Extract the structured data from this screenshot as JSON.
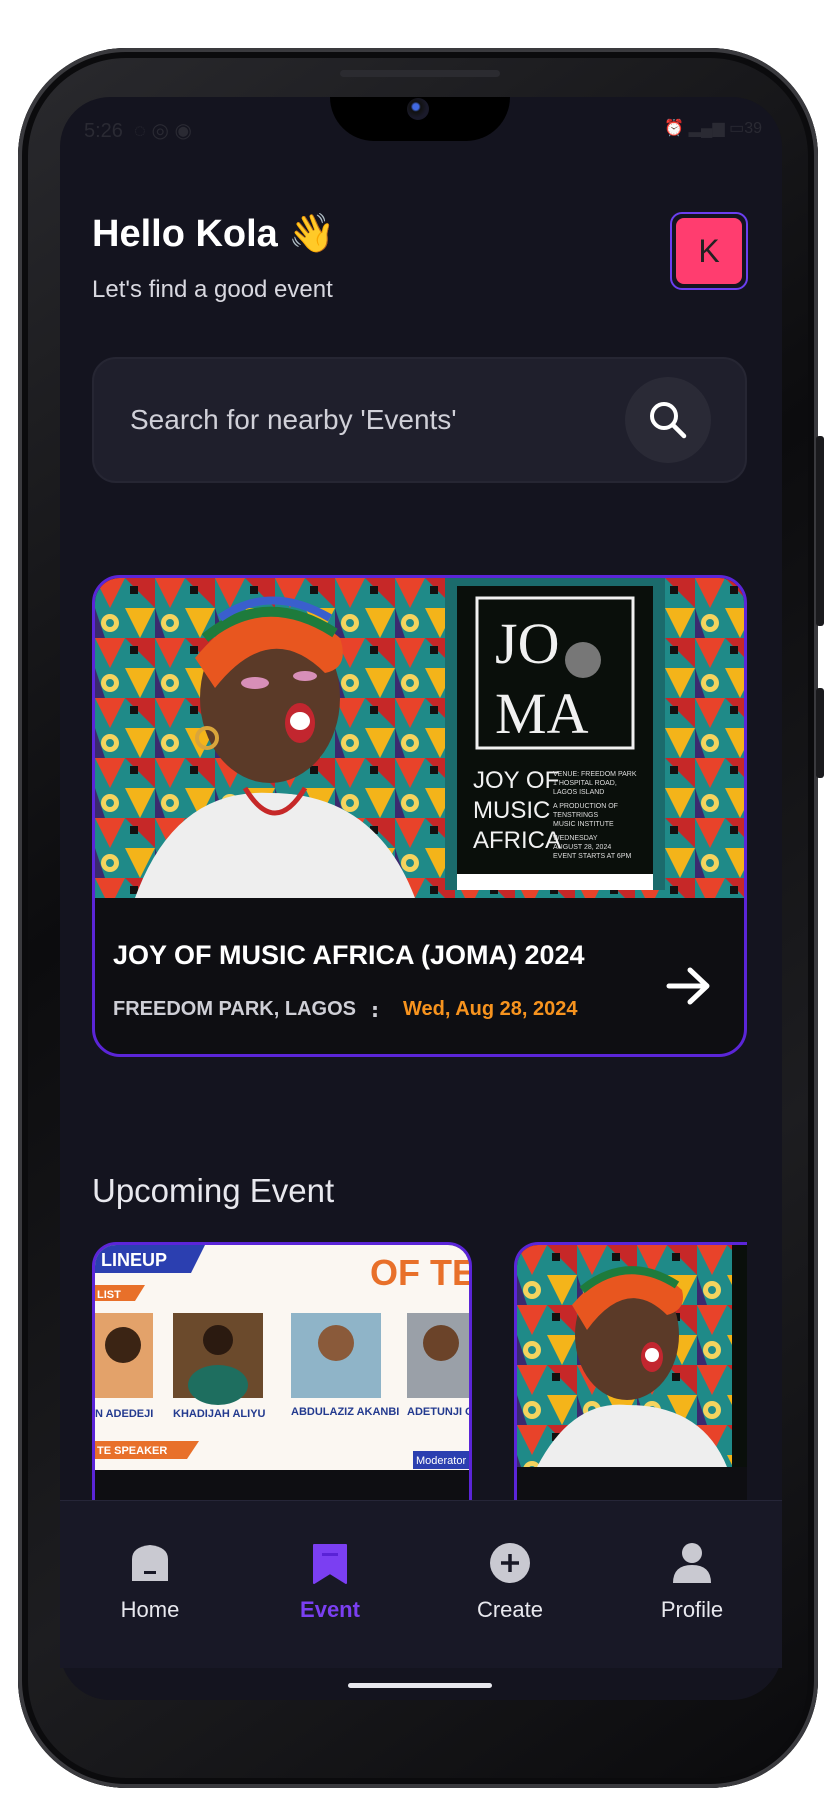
{
  "status": {
    "time": "5:26",
    "battery": "39"
  },
  "header": {
    "greeting": "Hello Kola 👋",
    "subtitle": "Let's find a good event",
    "avatar_initial": "K"
  },
  "search": {
    "placeholder": "Search for nearby 'Events'"
  },
  "featured": {
    "title": "JOY OF MUSIC AFRICA (JOMA) 2024",
    "location": "FREEDOM PARK, LAGOS",
    "separator": ":",
    "date": "Wed, Aug 28, 2024",
    "poster": {
      "logo_line1": "JO",
      "logo_line2": "MA",
      "name_line1": "JOY OF",
      "name_line2": "MUSIC",
      "name_line3": "AFRICA",
      "venue_lines": [
        "VENUE: FREEDOM PARK",
        "1 HOSPITAL ROAD,",
        "LAGOS ISLAND"
      ],
      "production_lines": [
        "A PRODUCTION OF",
        "TENSTRINGS",
        "MUSIC INSTITUTE"
      ],
      "date_lines": [
        "WEDNESDAY",
        "AUGUST 28, 2024",
        "EVENT STARTS AT 6PM"
      ]
    }
  },
  "upcoming": {
    "section_title": "Upcoming Event",
    "card1": {
      "banner": "LINEUP",
      "heading": "OF TEC",
      "list_label": "LIST",
      "names": [
        "N ADEDEJI",
        "KHADIJAH ALIYU",
        "ABDULAZIZ AKANBI",
        "ADETUNJI O. JACOB"
      ],
      "speaker_label": "TE SPEAKER",
      "moderator_label": "Moderator"
    }
  },
  "nav": {
    "items": [
      {
        "label": "Home",
        "icon": "home-icon"
      },
      {
        "label": "Event",
        "icon": "bookmark-icon"
      },
      {
        "label": "Create",
        "icon": "plus-circle-icon"
      },
      {
        "label": "Profile",
        "icon": "person-icon"
      }
    ],
    "active_index": 1
  },
  "colors": {
    "accent": "#5b25d8",
    "date": "#f7931e",
    "avatar": "#ff3d6f",
    "background": "#14141f"
  }
}
